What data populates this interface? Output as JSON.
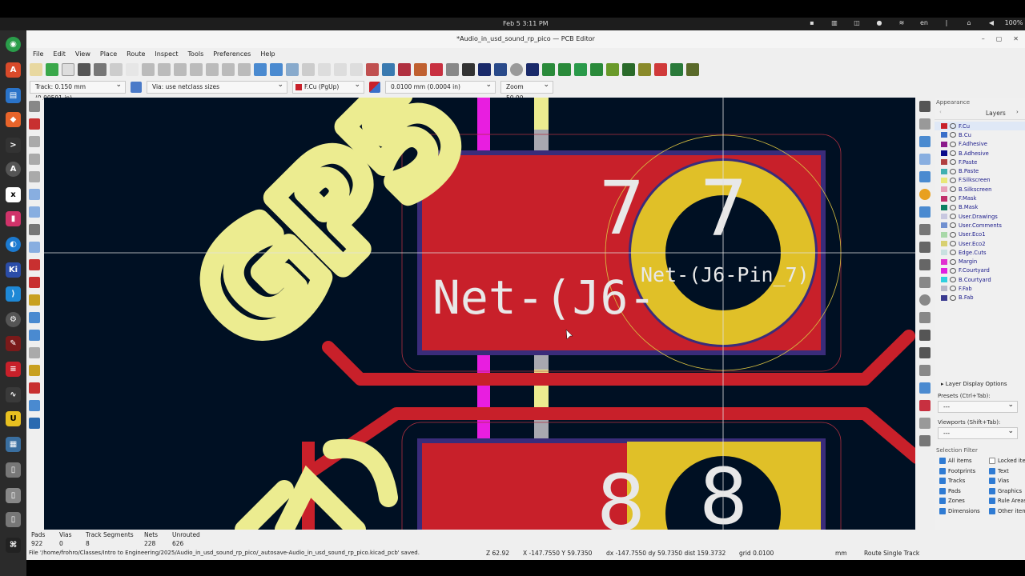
{
  "desktop": {
    "clock": "Feb 5   3:11 PM",
    "tray": [
      "en",
      "100%"
    ]
  },
  "window": {
    "title": "*Audio_in_usd_sound_rp_pico — PCB Editor"
  },
  "menu": [
    "File",
    "Edit",
    "View",
    "Place",
    "Route",
    "Inspect",
    "Tools",
    "Preferences",
    "Help"
  ],
  "toolbar2": {
    "track": "Track: 0.150 mm (0.00591 in)",
    "via": "Via: use netclass sizes",
    "layer": "F.Cu (PgUp)",
    "grid": "0.0100 mm (0.0004 in)",
    "zoom": "Zoom 50.00"
  },
  "canvas": {
    "silk_text": "GP5",
    "net_label_big": "Net-(J6-",
    "pad_num_7a": "7",
    "pad_num_7b": "7",
    "pad_net_label": "Net-(J6-Pin_7)",
    "pad_num_8a": "8",
    "pad_num_8b": "8"
  },
  "panel": {
    "title": "Appearance",
    "tab": "Layers",
    "layers": [
      {
        "name": "F.Cu",
        "color": "#c8202a"
      },
      {
        "name": "B.Cu",
        "color": "#3a6fc9"
      },
      {
        "name": "F.Adhesive",
        "color": "#8b1a8b"
      },
      {
        "name": "B.Adhesive",
        "color": "#0a0a8a"
      },
      {
        "name": "F.Paste",
        "color": "#b04040"
      },
      {
        "name": "B.Paste",
        "color": "#40b0b0"
      },
      {
        "name": "F.Silkscreen",
        "color": "#e8e878"
      },
      {
        "name": "B.Silkscreen",
        "color": "#e8a0b8"
      },
      {
        "name": "F.Mask",
        "color": "#c0306a"
      },
      {
        "name": "B.Mask",
        "color": "#0a8060"
      },
      {
        "name": "User.Drawings",
        "color": "#c8c8e0"
      },
      {
        "name": "User.Comments",
        "color": "#7090d0"
      },
      {
        "name": "User.Eco1",
        "color": "#a8d8a8"
      },
      {
        "name": "User.Eco2",
        "color": "#d8d070"
      },
      {
        "name": "Edge.Cuts",
        "color": "#c8e0e0"
      },
      {
        "name": "Margin",
        "color": "#e030d0"
      },
      {
        "name": "F.Courtyard",
        "color": "#e020e0"
      },
      {
        "name": "B.Courtyard",
        "color": "#30d0e0"
      },
      {
        "name": "F.Fab",
        "color": "#b8b8c8"
      },
      {
        "name": "B.Fab",
        "color": "#3a3a90"
      }
    ],
    "layer_display_options": "Layer Display Options",
    "presets_label": "Presets (Ctrl+Tab):",
    "presets_value": "---",
    "viewports_label": "Viewports (Shift+Tab):",
    "viewports_value": "---",
    "selection_filter": "Selection Filter",
    "filters": [
      {
        "label": "All items",
        "checked": true
      },
      {
        "label": "Locked ite",
        "checked": false
      },
      {
        "label": "Footprints",
        "checked": true
      },
      {
        "label": "Text",
        "checked": true
      },
      {
        "label": "Tracks",
        "checked": true
      },
      {
        "label": "Vias",
        "checked": true
      },
      {
        "label": "Pads",
        "checked": true
      },
      {
        "label": "Graphics",
        "checked": true
      },
      {
        "label": "Zones",
        "checked": true
      },
      {
        "label": "Rule Areas",
        "checked": true
      },
      {
        "label": "Dimensions",
        "checked": true
      },
      {
        "label": "Other item",
        "checked": true
      }
    ]
  },
  "status": {
    "headers": [
      "Pads",
      "Vias",
      "Track Segments",
      "Nets",
      "Unrouted"
    ],
    "values": [
      "922",
      "0",
      "8",
      "228",
      "626"
    ],
    "message": "File '/home/frohro/Classes/Intro to Engineering/2025/Audio_in_usd_sound_rp_pico/_autosave-Audio_in_usd_sound_rp_pico.kicad_pcb' saved.",
    "z": "Z 62.92",
    "xy": "X -147.7550  Y 59.7350",
    "delta": "dx -147.7550  dy 59.7350  dist 159.3732",
    "grid": "grid 0.0100",
    "units": "mm",
    "mode": "Route Single Track"
  }
}
